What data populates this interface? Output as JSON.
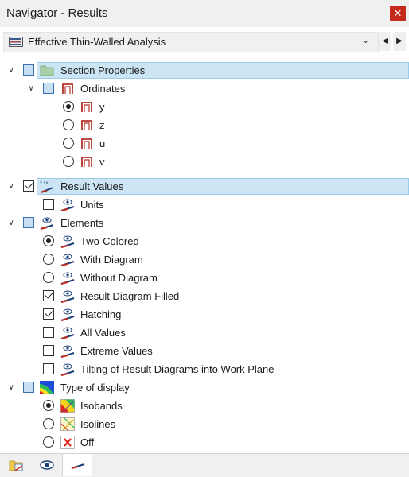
{
  "window": {
    "title": "Navigator - Results",
    "close_glyph": "✕"
  },
  "toolbar": {
    "dropdown_value": "Effective Thin-Walled Analysis",
    "chevron": "⌄",
    "prev_glyph": "◀",
    "next_glyph": "▶"
  },
  "tree": {
    "section_properties": {
      "label": "Section Properties",
      "expanded": true,
      "state": "partial",
      "icon": "folder-icon"
    },
    "ordinates": {
      "label": "Ordinates",
      "expanded": true,
      "state": "partial",
      "icon": "ordinate-section-icon",
      "options": [
        {
          "label": "y",
          "selected": true
        },
        {
          "label": "z",
          "selected": false
        },
        {
          "label": "u",
          "selected": false
        },
        {
          "label": "v",
          "selected": false
        }
      ]
    },
    "result_values": {
      "label": "Result Values",
      "expanded": true,
      "state": "checked",
      "icon_text": "x.xx"
    },
    "units": {
      "label": "Units",
      "checked": false
    },
    "elements": {
      "label": "Elements",
      "expanded": true,
      "state": "partial",
      "radio_options": [
        {
          "label": "Two-Colored",
          "selected": true
        },
        {
          "label": "With Diagram",
          "selected": false
        },
        {
          "label": "Without Diagram",
          "selected": false
        }
      ],
      "check_options": [
        {
          "label": "Result Diagram Filled",
          "checked": true
        },
        {
          "label": "Hatching",
          "checked": true
        },
        {
          "label": "All Values",
          "checked": false
        },
        {
          "label": "Extreme Values",
          "checked": false
        },
        {
          "label": "Tilting of Result Diagrams into Work Plane",
          "checked": false
        }
      ]
    },
    "type_of_display": {
      "label": "Type of display",
      "expanded": true,
      "state": "partial",
      "options": [
        {
          "label": "Isobands",
          "selected": true
        },
        {
          "label": "Isolines",
          "selected": false
        },
        {
          "label": "Off",
          "selected": false
        }
      ]
    }
  },
  "colors": {
    "highlight": "#cce5f5",
    "accent": "#c42b1c",
    "partial": "#c8e0f4"
  },
  "bottom_tabs": [
    {
      "icon": "data-folder-icon"
    },
    {
      "icon": "eye-icon"
    },
    {
      "icon": "results-diagram-icon"
    }
  ]
}
